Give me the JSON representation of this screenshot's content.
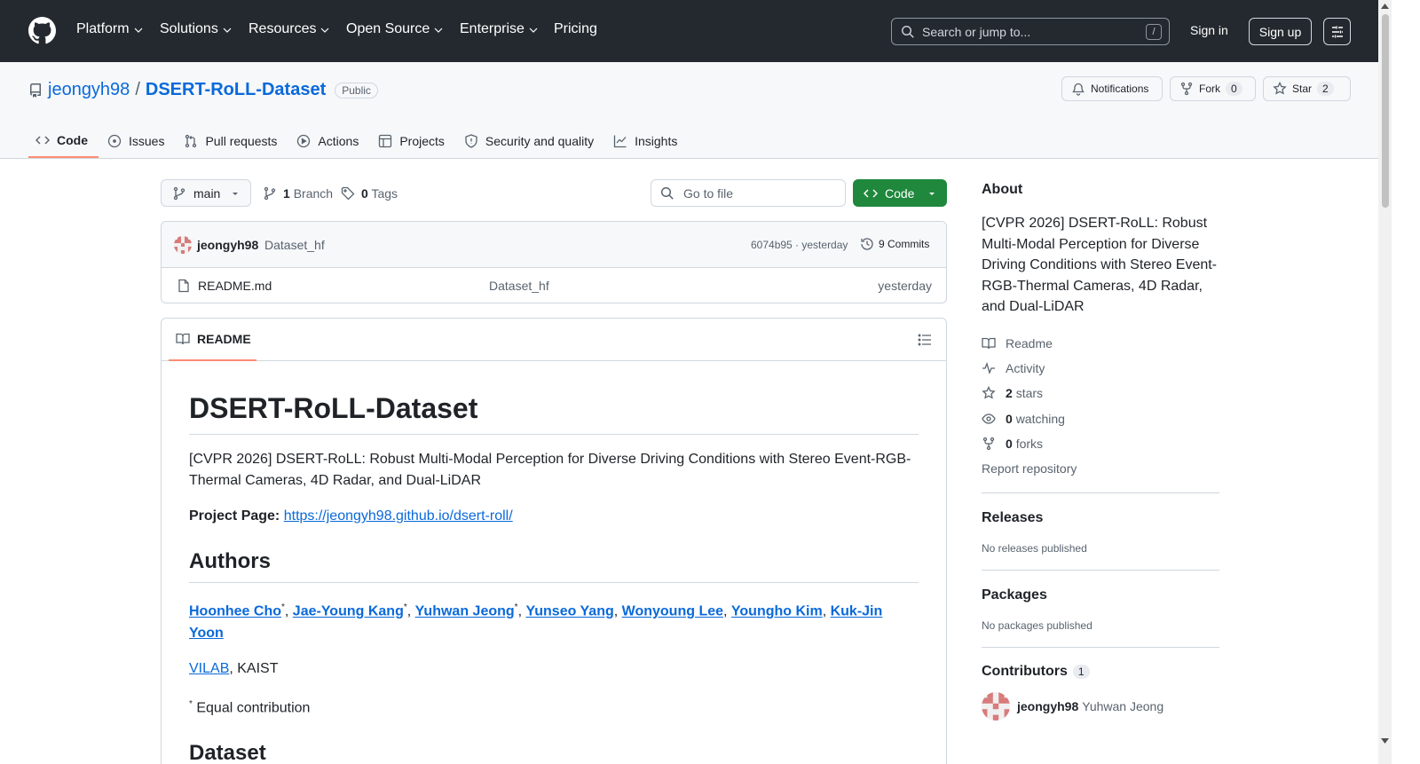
{
  "header": {
    "nav": [
      "Platform",
      "Solutions",
      "Resources",
      "Open Source",
      "Enterprise",
      "Pricing"
    ],
    "search_placeholder": "Search or jump to...",
    "search_shortcut": "/",
    "signin": "Sign in",
    "signup": "Sign up"
  },
  "repo": {
    "owner": "jeongyh98",
    "separator": "/",
    "name": "DSERT-RoLL-Dataset",
    "visibility": "Public",
    "notifications_label": "Notifications",
    "fork_label": "Fork",
    "fork_count": "0",
    "star_label": "Star",
    "star_count": "2",
    "tabs": [
      "Code",
      "Issues",
      "Pull requests",
      "Actions",
      "Projects",
      "Security and quality",
      "Insights"
    ]
  },
  "toolbar": {
    "branch": "main",
    "branch_count": "1",
    "branch_label": "Branch",
    "tag_count": "0",
    "tag_label": "Tags",
    "goto_placeholder": "Go to file",
    "code_button": "Code"
  },
  "commit": {
    "author": "jeongyh98",
    "message": "Dataset_hf",
    "hash_time": "6074b95 · yesterday",
    "commits_label": "9 Commits"
  },
  "files": [
    {
      "name": "README.md",
      "message": "Dataset_hf",
      "time": "yesterday"
    }
  ],
  "readme": {
    "tab_label": "README",
    "title": "DSERT-RoLL-Dataset",
    "description": "[CVPR 2026] DSERT-RoLL: Robust Multi-Modal Perception for Diverse Driving Conditions with Stereo Event-RGB-Thermal Cameras, 4D Radar, and Dual-LiDAR",
    "project_page_label": "Project Page:",
    "project_page_url": "https://jeongyh98.github.io/dsert-roll/",
    "authors_heading": "Authors",
    "authors": [
      {
        "name": "Hoonhee Cho",
        "mark": "*"
      },
      {
        "name": "Jae-Young Kang",
        "mark": "*"
      },
      {
        "name": "Yuhwan Jeong",
        "mark": "*"
      },
      {
        "name": "Yunseo Yang",
        "mark": ""
      },
      {
        "name": "Wonyoung Lee",
        "mark": ""
      },
      {
        "name": "Youngho Kim",
        "mark": ""
      },
      {
        "name": "Kuk-Jin Yoon",
        "mark": ""
      }
    ],
    "lab_link": "VILAB",
    "lab_suffix": ", KAIST",
    "equal_mark": "*",
    "equal_text": " Equal contribution",
    "dataset_heading": "Dataset"
  },
  "sidebar": {
    "about_heading": "About",
    "about_text": "[CVPR 2026] DSERT-RoLL: Robust Multi-Modal Perception for Diverse Driving Conditions with Stereo Event-RGB-Thermal Cameras, 4D Radar, and Dual-LiDAR",
    "readme": "Readme",
    "activity": "Activity",
    "stars_count": "2",
    "stars_label": "stars",
    "watching_count": "0",
    "watching_label": "watching",
    "forks_count": "0",
    "forks_label": "forks",
    "report": "Report repository",
    "releases_heading": "Releases",
    "releases_text": "No releases published",
    "packages_heading": "Packages",
    "packages_text": "No packages published",
    "contributors_heading": "Contributors",
    "contributors_count": "1",
    "contributor_login": "jeongyh98",
    "contributor_name": "Yuhwan Jeong"
  },
  "colors": {
    "header_bg": "#24292f",
    "link": "#0969da",
    "primary_button": "#1f883d",
    "active_tab_underline": "#fd8c73"
  }
}
